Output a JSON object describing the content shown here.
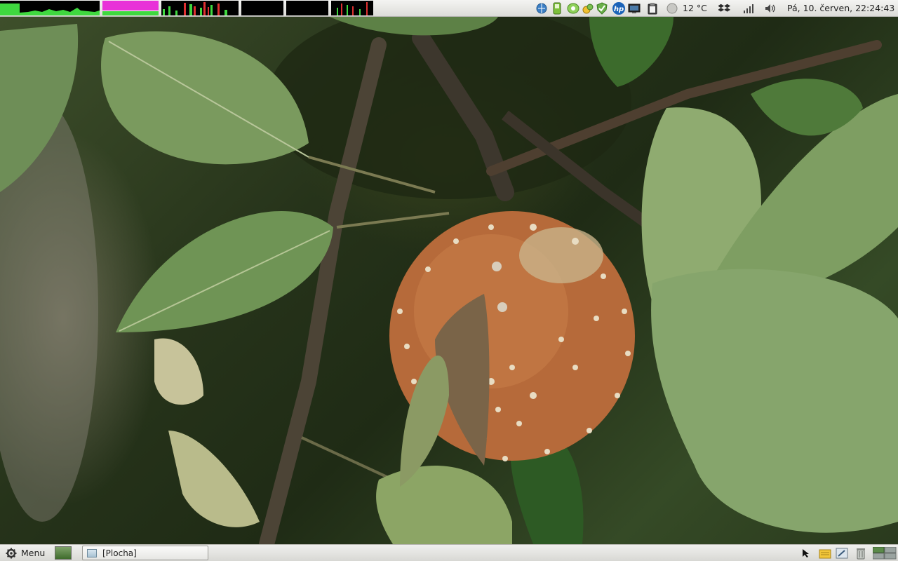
{
  "top_panel": {
    "weather": {
      "temperature": "12 °C"
    },
    "clock": "Pá, 10. červen, 22:24:43",
    "tray_icons": [
      "network-globe-icon",
      "phone-battery-icon",
      "chat-icon",
      "updates-icon",
      "shield-check-icon",
      "hp-printer-icon",
      "monitor-icon",
      "clipboard-icon",
      "weather-icon",
      "dropbox-icon",
      "signal-bars-icon",
      "volume-icon"
    ],
    "monitor_colors": {
      "cpu": "#3fd83f",
      "memory": "#e832d8",
      "net": "#e03030"
    }
  },
  "taskbar": {
    "menu_label": "Menu",
    "tasks": [
      {
        "label": "[Plocha]"
      }
    ]
  }
}
